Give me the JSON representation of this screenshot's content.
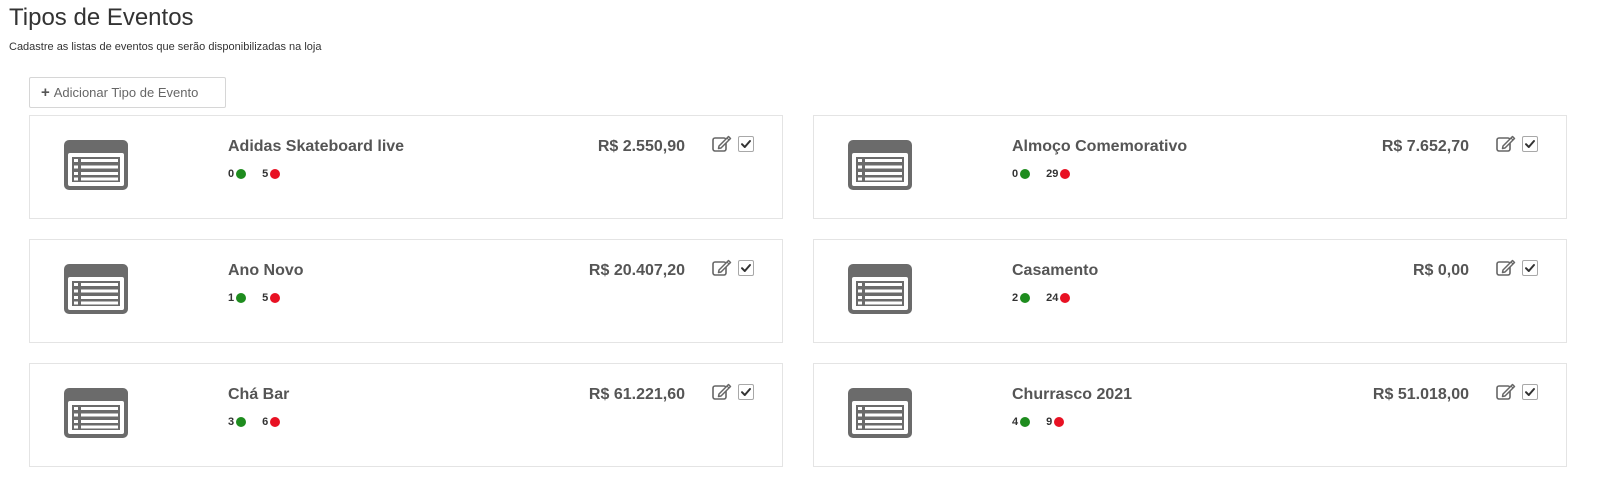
{
  "header": {
    "title": "Tipos de Eventos",
    "subtitle": "Cadastre as listas de eventos que serão disponibilizadas na loja"
  },
  "toolbar": {
    "add_label": "Adicionar Tipo de Evento"
  },
  "colors": {
    "active_dot": "#1e8c1e",
    "inactive_dot": "#e81123",
    "icon_gray": "#6b6b6b"
  },
  "events": [
    {
      "name": "Adidas Skateboard live",
      "price": "R$ 2.550,90",
      "green_count": "0",
      "red_count": "5"
    },
    {
      "name": "Almoço Comemorativo",
      "price": "R$ 7.652,70",
      "green_count": "0",
      "red_count": "29"
    },
    {
      "name": "Ano Novo",
      "price": "R$ 20.407,20",
      "green_count": "1",
      "red_count": "5"
    },
    {
      "name": "Casamento",
      "price": "R$ 0,00",
      "green_count": "2",
      "red_count": "24"
    },
    {
      "name": "Chá Bar",
      "price": "R$ 61.221,60",
      "green_count": "3",
      "red_count": "6"
    },
    {
      "name": "Churrasco 2021",
      "price": "R$ 51.018,00",
      "green_count": "4",
      "red_count": "9"
    }
  ]
}
